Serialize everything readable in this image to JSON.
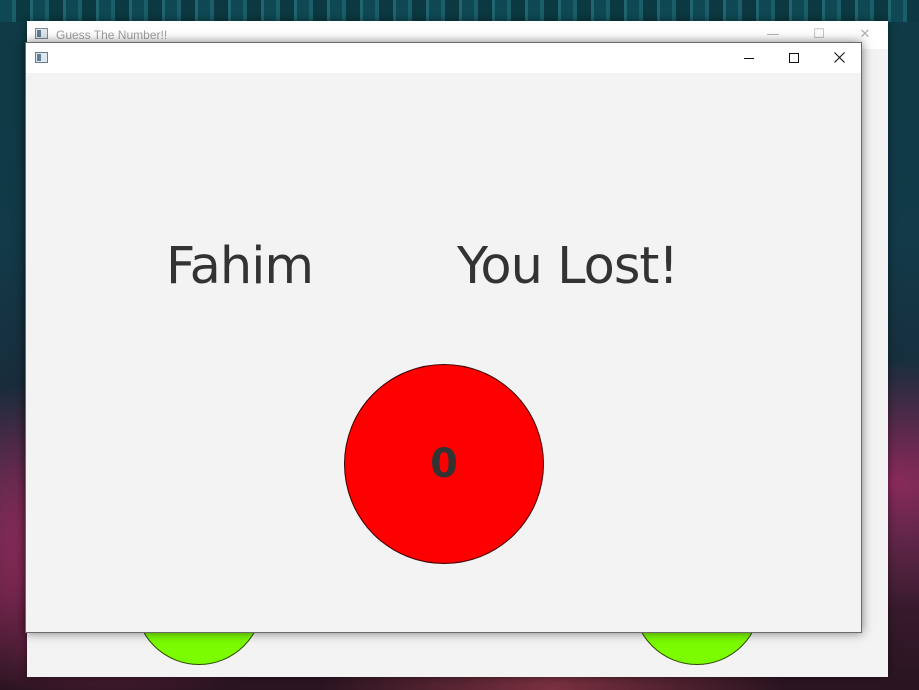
{
  "back_window": {
    "title": "Guess The Number!!",
    "controls": {
      "minimize": "—",
      "maximize": "☐",
      "close": "✕"
    }
  },
  "front_window": {
    "title": "",
    "player_name": "Fahim",
    "result": "You Lost!",
    "number": "0"
  },
  "colors": {
    "result_circle": "#ff0000",
    "guess_circle": "#7cfc00",
    "text": "#333333"
  }
}
